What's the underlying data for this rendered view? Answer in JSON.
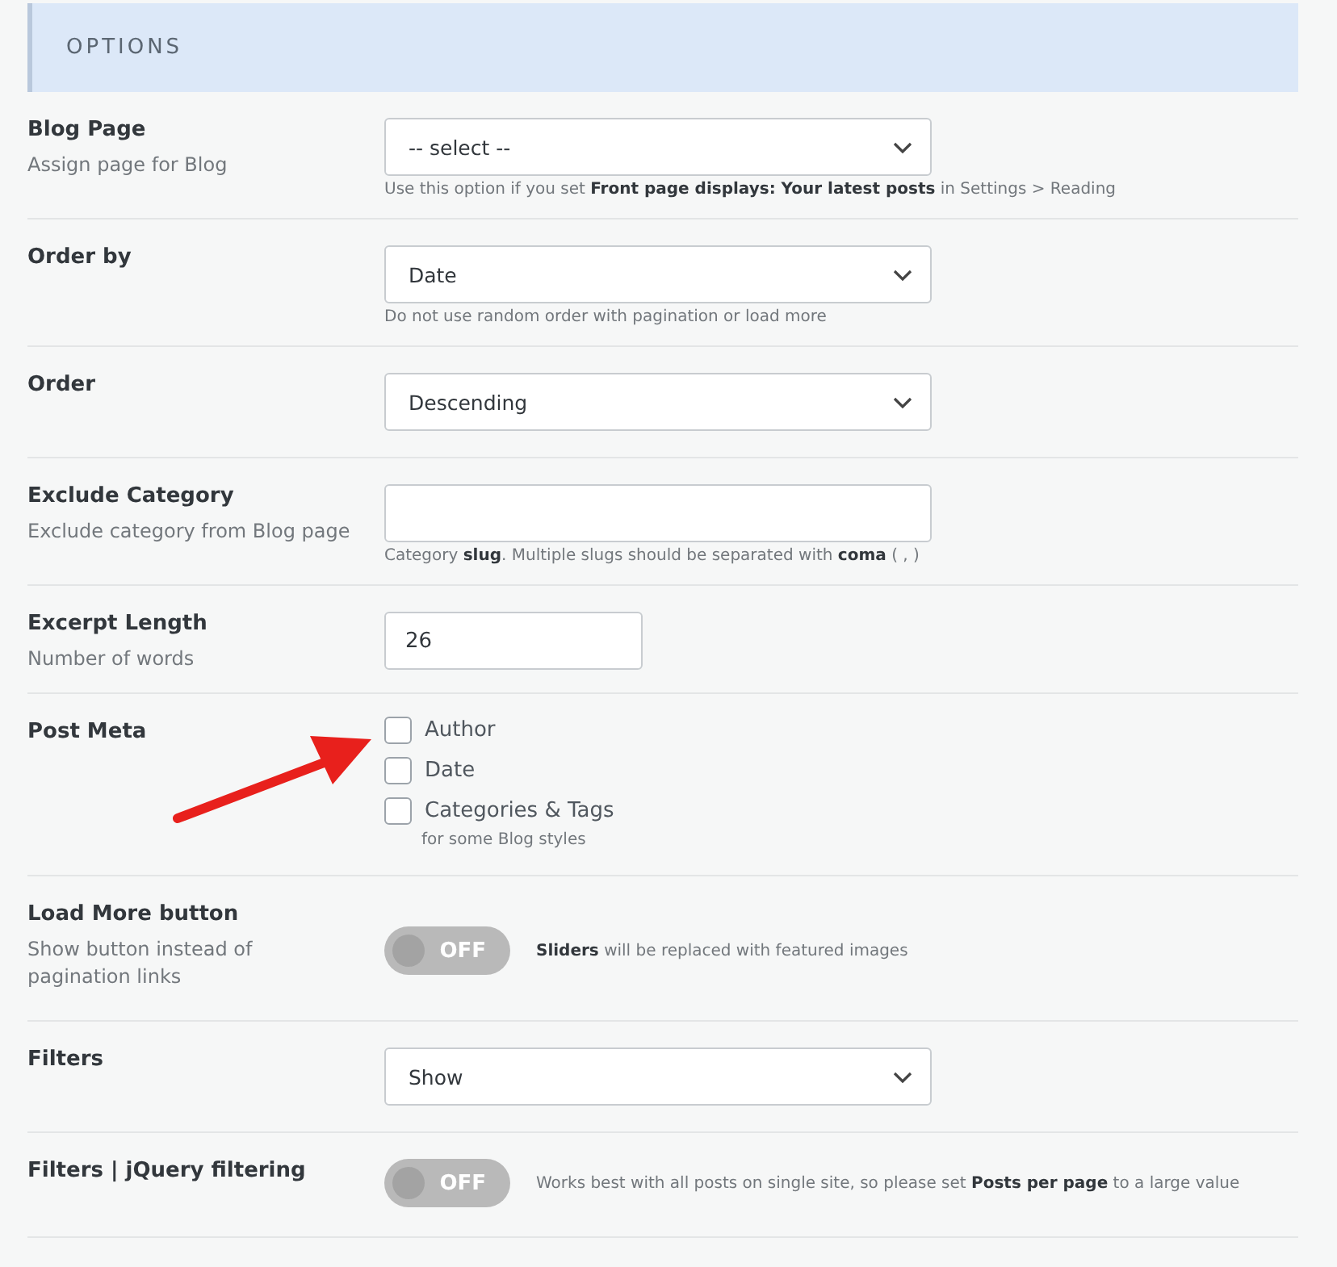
{
  "header": {
    "title": "OPTIONS"
  },
  "rows": [
    {
      "kind": "select",
      "label": "Blog Page",
      "description": "Assign page for Blog",
      "value": "-- select --",
      "hint": "Use this option if you set **Front page displays: Your latest posts** in Settings > Reading"
    },
    {
      "kind": "select",
      "label": "Order by",
      "value": "Date",
      "hint": "Do not use random order with pagination or load more"
    },
    {
      "kind": "select",
      "label": "Order",
      "value": "Descending"
    },
    {
      "kind": "text",
      "label": "Exclude Category",
      "description": "Exclude category from Blog page",
      "value": "",
      "hint": "Category **slug**. Multiple slugs should be separated with **coma** ( , )",
      "wide": true
    },
    {
      "kind": "text",
      "label": "Excerpt Length",
      "description": "Number of words",
      "value": "26",
      "wide": false
    },
    {
      "kind": "checkboxes",
      "label": "Post Meta",
      "options": [
        {
          "label": "Author",
          "checked": false
        },
        {
          "label": "Date",
          "checked": false
        },
        {
          "label": "Categories & Tags",
          "checked": false,
          "note": "for some Blog styles"
        }
      ],
      "arrow_marker": true
    },
    {
      "kind": "toggle",
      "label": "Load More button",
      "description": "Show button instead of pagination links",
      "on": false,
      "state_label": "OFF",
      "hint": "**Sliders** will be replaced with featured images"
    },
    {
      "kind": "select",
      "label": "Filters",
      "value": "Show"
    },
    {
      "kind": "toggle",
      "label": "Filters | jQuery filtering",
      "on": false,
      "state_label": "OFF",
      "hint": "Works best with all posts on single site, so please set **Posts per page** to a large value"
    }
  ]
}
